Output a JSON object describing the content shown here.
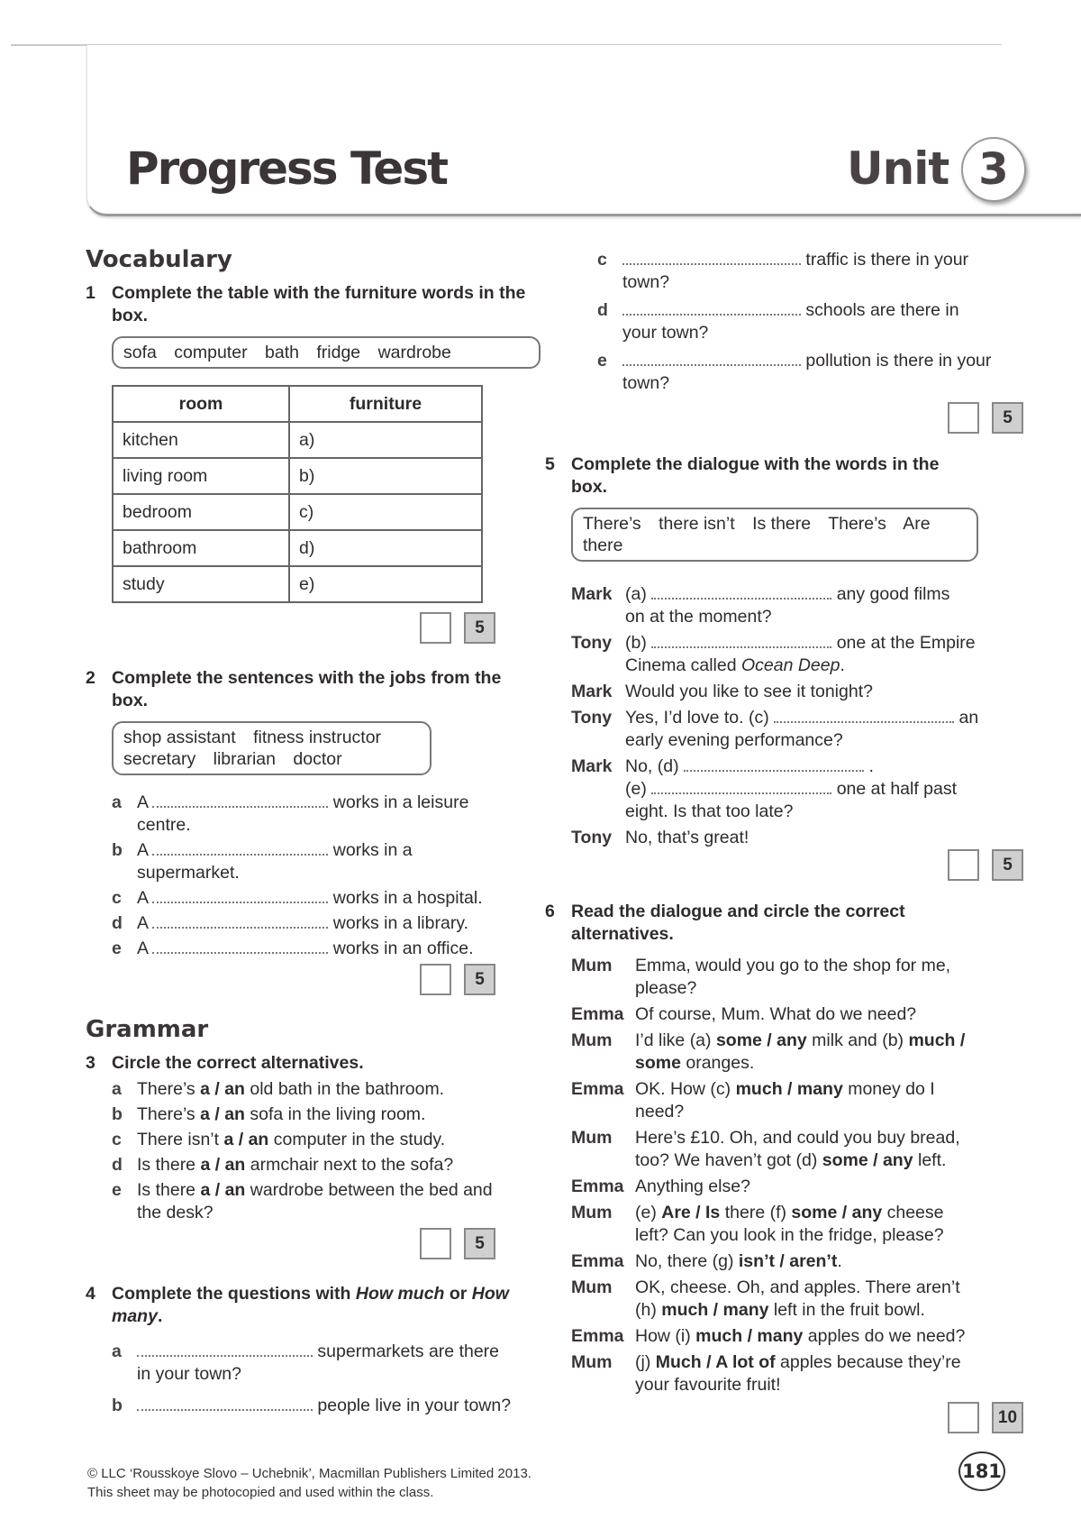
{
  "header": {
    "title": "Progress Test",
    "unit_label": "Unit",
    "unit_number": "3"
  },
  "vocabulary": {
    "heading": "Vocabulary",
    "ex1": {
      "number": "1",
      "instruction": "Complete the table with the furniture words in the box.",
      "word_box": [
        "sofa",
        "computer",
        "bath",
        "fridge",
        "wardrobe"
      ],
      "table": {
        "headers": [
          "room",
          "furniture"
        ],
        "rows": [
          [
            "kitchen",
            "a)"
          ],
          [
            "living room",
            "b)"
          ],
          [
            "bedroom",
            "c)"
          ],
          [
            "bathroom",
            "d)"
          ],
          [
            "study",
            "e)"
          ]
        ]
      },
      "max_score": "5"
    },
    "ex2": {
      "number": "2",
      "instruction": "Complete the sentences with the jobs from the box.",
      "word_box_line1": [
        "shop assistant",
        "fitness instructor"
      ],
      "word_box_line2": [
        "secretary",
        "librarian",
        "doctor"
      ],
      "items": [
        {
          "letter": "a",
          "before": "A",
          "after": "works in a leisure centre."
        },
        {
          "letter": "b",
          "before": "A",
          "after": "works in a supermarket."
        },
        {
          "letter": "c",
          "before": "A",
          "after": "works in a hospital."
        },
        {
          "letter": "d",
          "before": "A",
          "after": "works in a library."
        },
        {
          "letter": "e",
          "before": "A",
          "after": "works in an office."
        }
      ],
      "max_score": "5"
    }
  },
  "grammar": {
    "heading": "Grammar",
    "ex3": {
      "number": "3",
      "instruction": "Circle the correct alternatives.",
      "items": [
        {
          "letter": "a",
          "before": "There’s",
          "options": "a / an",
          "after": "old bath in the bathroom."
        },
        {
          "letter": "b",
          "before": "There’s",
          "options": "a / an",
          "after": "sofa in the living room."
        },
        {
          "letter": "c",
          "before": "There isn’t",
          "options": "a / an",
          "after": "computer in the study."
        },
        {
          "letter": "d",
          "before": "Is there",
          "options": "a / an",
          "after": "armchair next to the sofa?"
        },
        {
          "letter": "e",
          "before": "Is there",
          "options": "a / an",
          "after": "wardrobe between the bed and the desk?"
        }
      ],
      "max_score": "5"
    },
    "ex4": {
      "number": "4",
      "instruction_prefix": "Complete the questions with",
      "instruction_em1": "How much",
      "instruction_mid": "or",
      "instruction_em2": "How many",
      "instruction_suffix": ".",
      "items": [
        {
          "letter": "a",
          "after": "supermarkets are there in your town?"
        },
        {
          "letter": "b",
          "after": "people live in your town?"
        },
        {
          "letter": "c",
          "after": "traffic is there in your town?"
        },
        {
          "letter": "d",
          "after": "schools are there in your town?"
        },
        {
          "letter": "e",
          "after": "pollution is there in your town?"
        }
      ],
      "max_score": "5"
    },
    "ex5": {
      "number": "5",
      "instruction": "Complete the dialogue with the words in the box.",
      "word_box": [
        "There’s",
        "there isn’t",
        "Is there",
        "There’s",
        "Are there"
      ],
      "lines": [
        {
          "speaker": "Mark",
          "pre": "(a)",
          "post": "any good  films on at the moment?"
        },
        {
          "speaker": "Tony",
          "pre": "(b)",
          "post": "one at the Empire Cinema called",
          "em": "Ocean Deep",
          "end": "."
        },
        {
          "speaker": "Mark",
          "text": "Would you like to see it tonight?"
        },
        {
          "speaker": "Tony",
          "pre": "Yes, I’d love to. (c)",
          "post": "an early evening performance?"
        },
        {
          "speaker": "Mark",
          "pre": "No, (d)",
          "mid": ".",
          "pre2": "(e)",
          "post": "one at half past eight. Is that too late?"
        },
        {
          "speaker": "Tony",
          "text": "No, that’s great!"
        }
      ],
      "max_score": "5"
    },
    "ex6": {
      "number": "6",
      "instruction": "Read the dialogue and circle the correct alternatives.",
      "lines": [
        {
          "speaker": "Mum",
          "parts": [
            {
              "t": "Emma, would you go to the shop for me, please?"
            }
          ]
        },
        {
          "speaker": "Emma",
          "parts": [
            {
              "t": "Of course, Mum. What do we need?"
            }
          ]
        },
        {
          "speaker": "Mum",
          "parts": [
            {
              "t": "I’d like (a) "
            },
            {
              "b": "some / any"
            },
            {
              "t": " milk and (b) "
            },
            {
              "b": "much / some"
            },
            {
              "t": " oranges."
            }
          ]
        },
        {
          "speaker": "Emma",
          "parts": [
            {
              "t": "OK. How (c) "
            },
            {
              "b": "much / many"
            },
            {
              "t": " money do I need?"
            }
          ]
        },
        {
          "speaker": "Mum",
          "parts": [
            {
              "t": "Here’s £10. Oh, and could you buy bread, too? We haven’t got (d) "
            },
            {
              "b": "some / any"
            },
            {
              "t": " left."
            }
          ]
        },
        {
          "speaker": "Emma",
          "parts": [
            {
              "t": "Anything else?"
            }
          ]
        },
        {
          "speaker": "Mum",
          "parts": [
            {
              "t": "(e) "
            },
            {
              "b": "Are / Is"
            },
            {
              "t": " there (f) "
            },
            {
              "b": "some / any"
            },
            {
              "t": " cheese left? Can you look in the fridge, please?"
            }
          ]
        },
        {
          "speaker": "Emma",
          "parts": [
            {
              "t": "No, there (g) "
            },
            {
              "b": "isn’t / aren’t"
            },
            {
              "t": "."
            }
          ]
        },
        {
          "speaker": "Mum",
          "parts": [
            {
              "t": "OK, cheese. Oh, and apples. There aren’t (h) "
            },
            {
              "b": "much / many"
            },
            {
              "t": " left in the fruit bowl."
            }
          ]
        },
        {
          "speaker": "Emma",
          "parts": [
            {
              "t": "How (i) "
            },
            {
              "b": "much / many"
            },
            {
              "t": " apples do we need?"
            }
          ]
        },
        {
          "speaker": "Mum",
          "parts": [
            {
              "t": "(j) "
            },
            {
              "b": "Much / A lot of"
            },
            {
              "t": " apples because they’re your favourite fruit!"
            }
          ]
        }
      ],
      "max_score": "10"
    }
  },
  "footer": {
    "copyright": "© LLC ‘Rousskoye Slovo – Uchebnik’, Macmillan Publishers Limited 2013.",
    "note": "This sheet may be photocopied and used within the class.",
    "page_number": "181"
  }
}
